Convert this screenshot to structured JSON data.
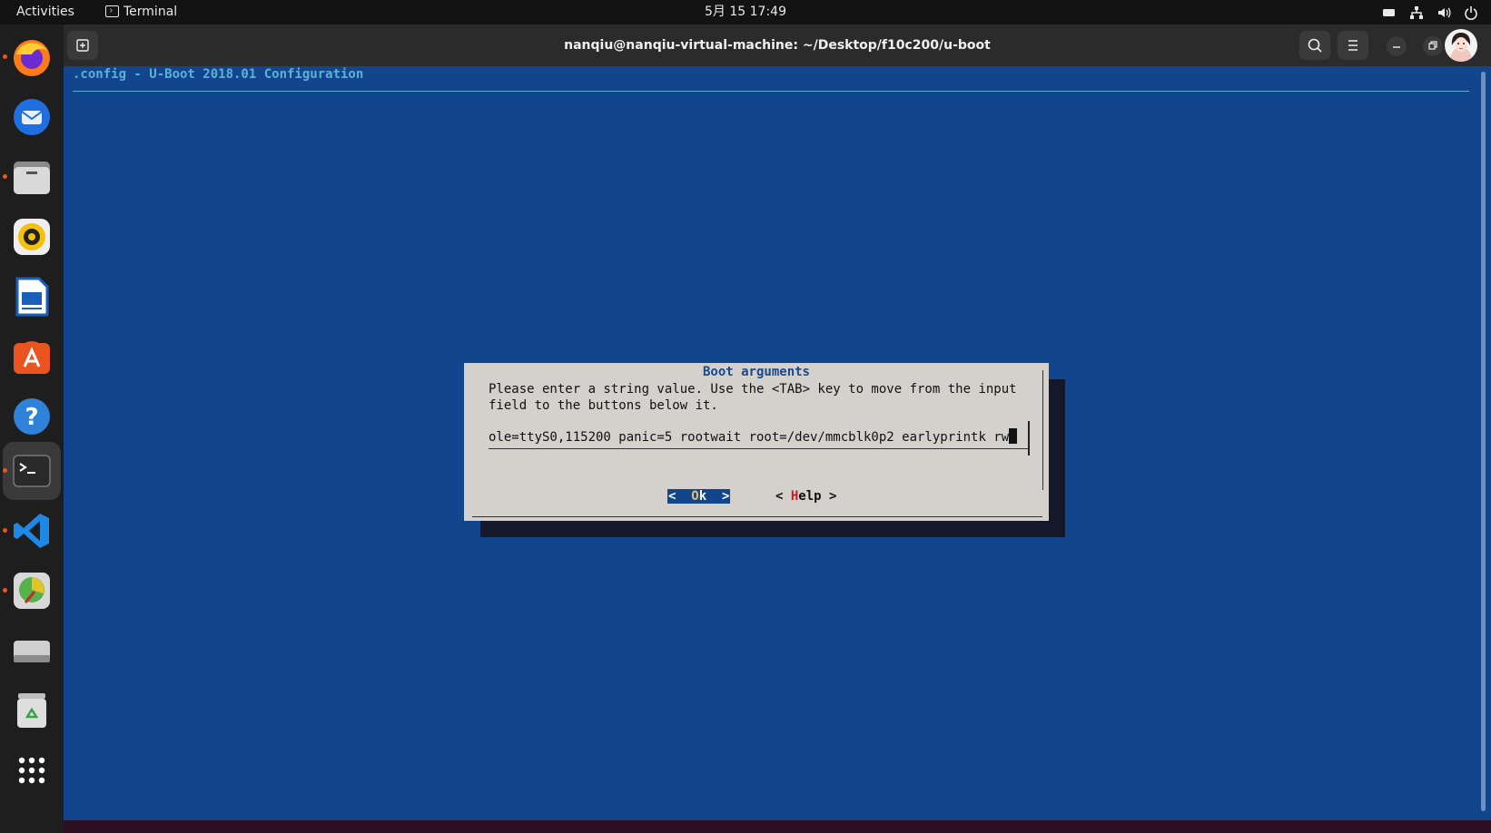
{
  "topbar": {
    "activities": "Activities",
    "app_name": "Terminal",
    "clock": "5月 15  17:49",
    "tray_icons": [
      "battery-icon",
      "network-icon",
      "volume-icon",
      "power-icon"
    ]
  },
  "dock": {
    "apps": [
      "firefox",
      "thunderbird",
      "files",
      "rhythmbox",
      "libreoffice-writer",
      "ubuntu-software",
      "help",
      "terminal",
      "vscode",
      "disk-usage-analyzer",
      "drive",
      "trash",
      "show-applications"
    ]
  },
  "window": {
    "title": "nanqiu@nanqiu-virtual-machine: ~/Desktop/f10c200/u-boot",
    "close_glyph": "⧉"
  },
  "terminal": {
    "config_title": ".config - U-Boot 2018.01 Configuration",
    "dialog": {
      "title": "Boot arguments",
      "prompt": "Please enter a string value. Use the <TAB> key to move from the input\nfield to the buttons below it.",
      "input_value": "ole=ttyS0,115200 panic=5 rootwait root=/dev/mmcblk0p2 earlyprintk rw",
      "ok_left": "<  ",
      "ok_hot": "O",
      "ok_rest": "k  >",
      "help_left": "< ",
      "help_hot": "H",
      "help_rest": "elp >"
    }
  },
  "colors": {
    "terminal_bg": "#11458c",
    "dialog_bg": "#d4d0cc",
    "title_cyan": "#5fb0d8",
    "accent": "#e95420"
  }
}
